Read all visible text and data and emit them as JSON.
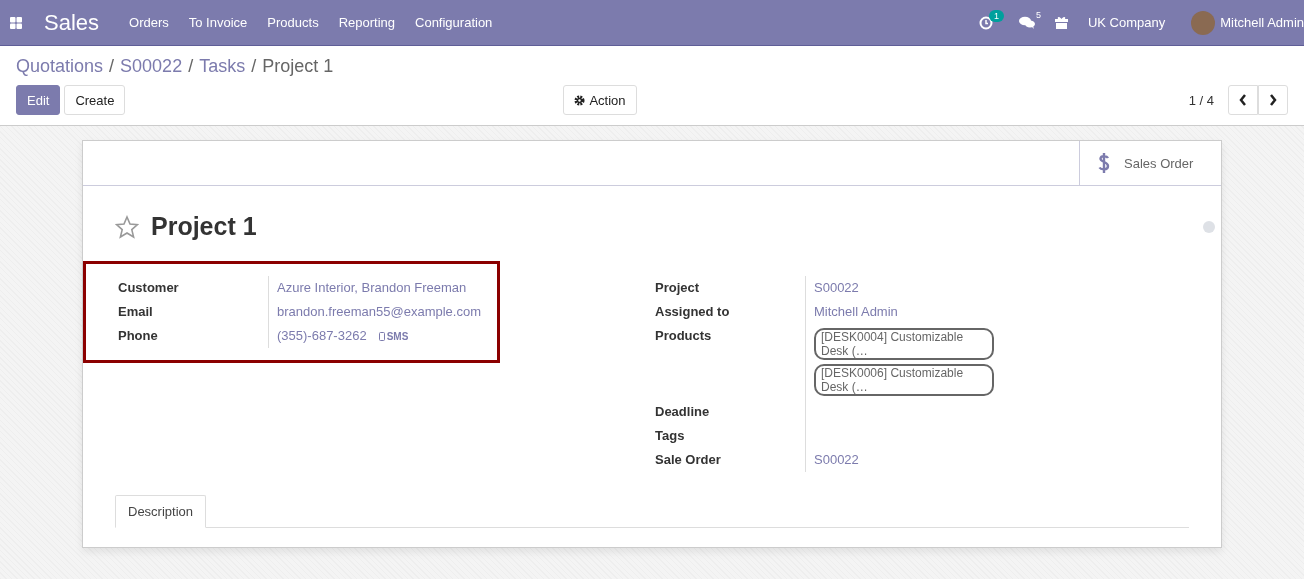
{
  "navbar": {
    "app": "Sales",
    "menu": [
      "Orders",
      "To Invoice",
      "Products",
      "Reporting",
      "Configuration"
    ],
    "activity_count": "1",
    "message_count": "5",
    "company": "UK Company",
    "user": "Mitchell Admin"
  },
  "breadcrumb_separator": "/",
  "breadcrumb": [
    {
      "label": "Quotations",
      "kind": "link"
    },
    {
      "label": "S00022",
      "kind": "link"
    },
    {
      "label": "Tasks",
      "kind": "link"
    },
    {
      "label": "Project 1",
      "kind": "current"
    }
  ],
  "buttons": {
    "edit": "Edit",
    "create": "Create",
    "action": "Action"
  },
  "pager": "1 / 4",
  "smart_button": "Sales Order",
  "record": {
    "title": "Project 1",
    "starred": false
  },
  "left_group": {
    "highlighted": true,
    "fields": [
      {
        "label": "Customer",
        "kind": "link",
        "value": "Azure Interior, Brandon Freeman"
      },
      {
        "label": "Email",
        "kind": "link",
        "value": "brandon.freeman55@example.com"
      },
      {
        "label": "Phone",
        "kind": "phone",
        "value": "(355)-687-3262",
        "sms": "SMS"
      }
    ]
  },
  "right_group": {
    "highlighted": false,
    "fields": [
      {
        "label": "Project",
        "kind": "link",
        "value": "S00022"
      },
      {
        "label": "Assigned to",
        "kind": "link",
        "value": "Mitchell Admin"
      },
      {
        "label": "Products",
        "kind": "tags",
        "tags": [
          "[DESK0004] Customizable Desk (…",
          "[DESK0006] Customizable Desk (…"
        ]
      },
      {
        "label": "Deadline",
        "kind": "empty"
      },
      {
        "label": "Tags",
        "kind": "empty"
      },
      {
        "label": "Sale Order",
        "kind": "link",
        "value": "S00022"
      }
    ]
  },
  "tabs": [
    {
      "label": "Description",
      "selected": true
    }
  ]
}
